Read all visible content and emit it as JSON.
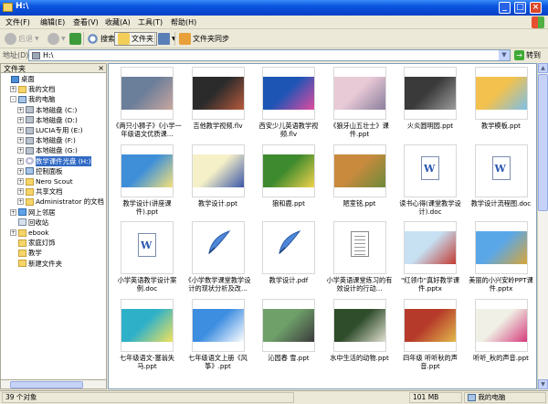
{
  "window": {
    "title": "H:\\"
  },
  "menu": [
    "文件(F)",
    "编辑(E)",
    "查看(V)",
    "收藏(A)",
    "工具(T)",
    "帮助(H)"
  ],
  "toolbar": {
    "back": "后退",
    "search": "搜索",
    "folders": "文件夹",
    "sync": "文件夹同步"
  },
  "address": {
    "label": "地址(D)",
    "value": "H:\\",
    "go": "转到"
  },
  "panel": {
    "title": "文件夹",
    "close": "×"
  },
  "tree": [
    {
      "label": "桌面",
      "pm": "",
      "icon": "desk"
    },
    {
      "label": "我的文档",
      "pm": "+",
      "icon": "folder"
    },
    {
      "label": "我的电脑",
      "pm": "-",
      "icon": "comp"
    },
    {
      "label": "本地磁盘 (C:)",
      "pm": "+",
      "icon": "drive"
    },
    {
      "label": "本地磁盘 (D:)",
      "pm": "+",
      "icon": "drive"
    },
    {
      "label": "LUCIA专用 (E:)",
      "pm": "+",
      "icon": "drive"
    },
    {
      "label": "本地磁盘 (F:)",
      "pm": "+",
      "icon": "drive"
    },
    {
      "label": "本地磁盘 (G:)",
      "pm": "+",
      "icon": "drive"
    },
    {
      "label": "数学课件光盘 (H:)",
      "pm": "+",
      "icon": "cd",
      "selected": true
    },
    {
      "label": "控制面板",
      "pm": "+",
      "icon": "comp"
    },
    {
      "label": "Nero Scout",
      "pm": "+",
      "icon": "folder"
    },
    {
      "label": "共享文档",
      "pm": "+",
      "icon": "folder"
    },
    {
      "label": "Administrator 的文档",
      "pm": "+",
      "icon": "folder"
    },
    {
      "label": "网上邻居",
      "pm": "+",
      "icon": "net"
    },
    {
      "label": "回收站",
      "pm": "",
      "icon": "bin"
    },
    {
      "label": "ebook",
      "pm": "+",
      "icon": "folder"
    },
    {
      "label": "家庭灯饰",
      "pm": "",
      "icon": "folder"
    },
    {
      "label": "教学",
      "pm": "",
      "icon": "folder"
    },
    {
      "label": "新建文件夹",
      "pm": "",
      "icon": "folder"
    }
  ],
  "files": [
    {
      "name": "《两只小狮子》《小学一年级语文优质课...",
      "kind": "img",
      "c1": "#6B7E9A",
      "c2": "#C9A7A0"
    },
    {
      "name": "吉他教学视频.flv",
      "kind": "img",
      "c1": "#2B2B2B",
      "c2": "#B85A3C"
    },
    {
      "name": "西安少儿英语教学视频.flv",
      "kind": "img",
      "c1": "#1D55B5",
      "c2": "#E24BA0"
    },
    {
      "name": "《狼牙山五壮士》课件.ppt",
      "kind": "img",
      "c1": "#E8C9D6",
      "c2": "#8A7F9C"
    },
    {
      "name": "火炎圆明园.ppt",
      "kind": "img",
      "c1": "#3A3A3A",
      "c2": "#9C9C9C"
    },
    {
      "name": "教学模板.ppt",
      "kind": "img",
      "c1": "#F2C14E",
      "c2": "#7DC0E8"
    },
    {
      "name": "教学设计(讲座课件).ppt",
      "kind": "img",
      "c1": "#3E8FD8",
      "c2": "#F5E27A"
    },
    {
      "name": "教学设计.ppt",
      "kind": "img",
      "c1": "#F5F0C8",
      "c2": "#3A56A8"
    },
    {
      "name": "狼和鹿.ppt",
      "kind": "img",
      "c1": "#3E8A2E",
      "c2": "#F2D34B"
    },
    {
      "name": "陋室铭.ppt",
      "kind": "img",
      "c1": "#C98A3E",
      "c2": "#6C8A3A"
    },
    {
      "name": "读书心得(课堂教学设计).doc",
      "kind": "doc"
    },
    {
      "name": "教学设计流程图.doc",
      "kind": "doc"
    },
    {
      "name": "小学英语教学设计案例.doc",
      "kind": "doc"
    },
    {
      "name": "《小学数学课堂教学设计的现状分析及改...",
      "kind": "pdf"
    },
    {
      "name": "教学设计.pdf",
      "kind": "pdf"
    },
    {
      "name": "小学英语课堂练习的有效设计的行动...",
      "kind": "txt"
    },
    {
      "name": "\"红领巾\"真好教学课件.pptx",
      "kind": "img",
      "c1": "#C7E0F2",
      "c2": "#C23B32"
    },
    {
      "name": "美丽的小兴安岭PPT课件.pptx",
      "kind": "img",
      "c1": "#5AA7E8",
      "c2": "#D7A63A"
    },
    {
      "name": "七年级语文-塞翁失马.ppt",
      "kind": "img",
      "c1": "#2FB0C9",
      "c2": "#F2E35B"
    },
    {
      "name": "七年级语文上册《风筝》.ppt",
      "kind": "img",
      "c1": "#3D8DE0",
      "c2": "#FFFFFF"
    },
    {
      "name": "沁园春  雪.ppt",
      "kind": "img",
      "c1": "#6FA06A",
      "c2": "#3B3B3B"
    },
    {
      "name": "水中生活的动物.ppt",
      "kind": "img",
      "c1": "#2F4C2B",
      "c2": "#E0E0D0"
    },
    {
      "name": "四年级  听听秋的声音.ppt",
      "kind": "img",
      "c1": "#B53A2A",
      "c2": "#E2B94B"
    },
    {
      "name": "听听_秋的声音.ppt",
      "kind": "img",
      "c1": "#F0F0E6",
      "c2": "#D43B7A"
    }
  ],
  "status": {
    "count": "39 个对象",
    "size": "101 MB",
    "location": "我的电脑"
  }
}
